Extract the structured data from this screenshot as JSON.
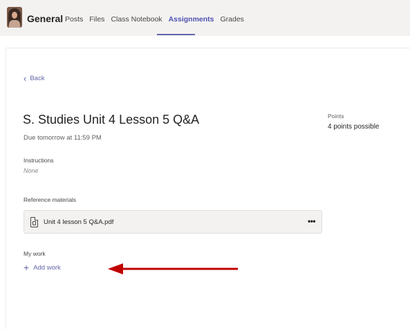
{
  "header": {
    "channel": "General",
    "tabs": [
      {
        "label": "Posts"
      },
      {
        "label": "Files"
      },
      {
        "label": "Class Notebook"
      },
      {
        "label": "Assignments"
      },
      {
        "label": "Grades"
      }
    ],
    "active_tab": "Assignments"
  },
  "nav": {
    "back_label": "Back"
  },
  "assignment": {
    "title": "S. Studies Unit 4 Lesson 5 Q&A",
    "due": "Due tomorrow at 11:59 PM",
    "instructions_label": "Instructions",
    "instructions_value": "None",
    "reference_label": "Reference materials",
    "reference_file": "Unit 4 lesson 5 Q&A.pdf",
    "more_glyph": "•••",
    "my_work_label": "My work",
    "add_work_label": "Add work"
  },
  "points": {
    "label": "Points",
    "value": "4 points possible"
  },
  "colors": {
    "accent": "#6264a7",
    "annotation_arrow": "#c00000"
  },
  "icons": [
    "avatar",
    "back-chevron-icon",
    "pdf-file-icon",
    "more-options-icon",
    "plus-icon",
    "annotation-arrow"
  ]
}
